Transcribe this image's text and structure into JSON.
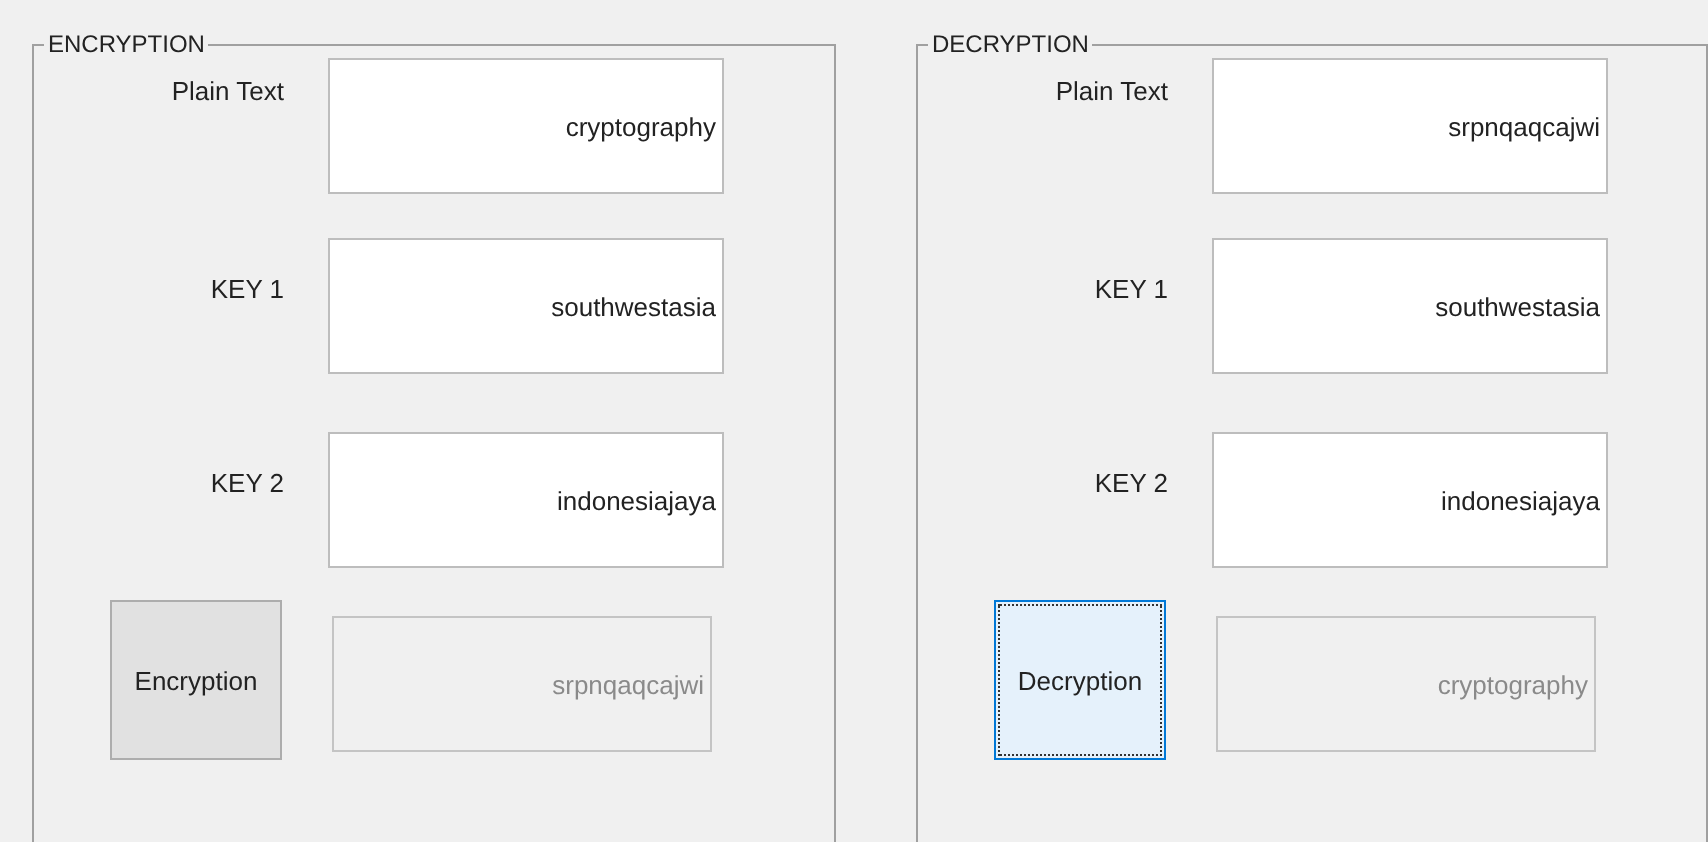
{
  "panels": [
    {
      "title": "ENCRYPTION",
      "fields": [
        {
          "label": "Plain Text",
          "value": "cryptography"
        },
        {
          "label": "KEY 1",
          "value": "southwestasia"
        },
        {
          "label": "KEY 2",
          "value": "indonesiajaya"
        }
      ],
      "button": {
        "label": "Encryption",
        "focused": false
      },
      "output": {
        "value": "srpnqaqcajwi",
        "disabled": true
      }
    },
    {
      "title": "DECRYPTION",
      "fields": [
        {
          "label": "Plain Text",
          "value": "srpnqaqcajwi"
        },
        {
          "label": "KEY 1",
          "value": "southwestasia"
        },
        {
          "label": "KEY 2",
          "value": "indonesiajaya"
        }
      ],
      "button": {
        "label": "Decryption",
        "focused": true
      },
      "output": {
        "value": "cryptography",
        "disabled": true
      }
    }
  ]
}
